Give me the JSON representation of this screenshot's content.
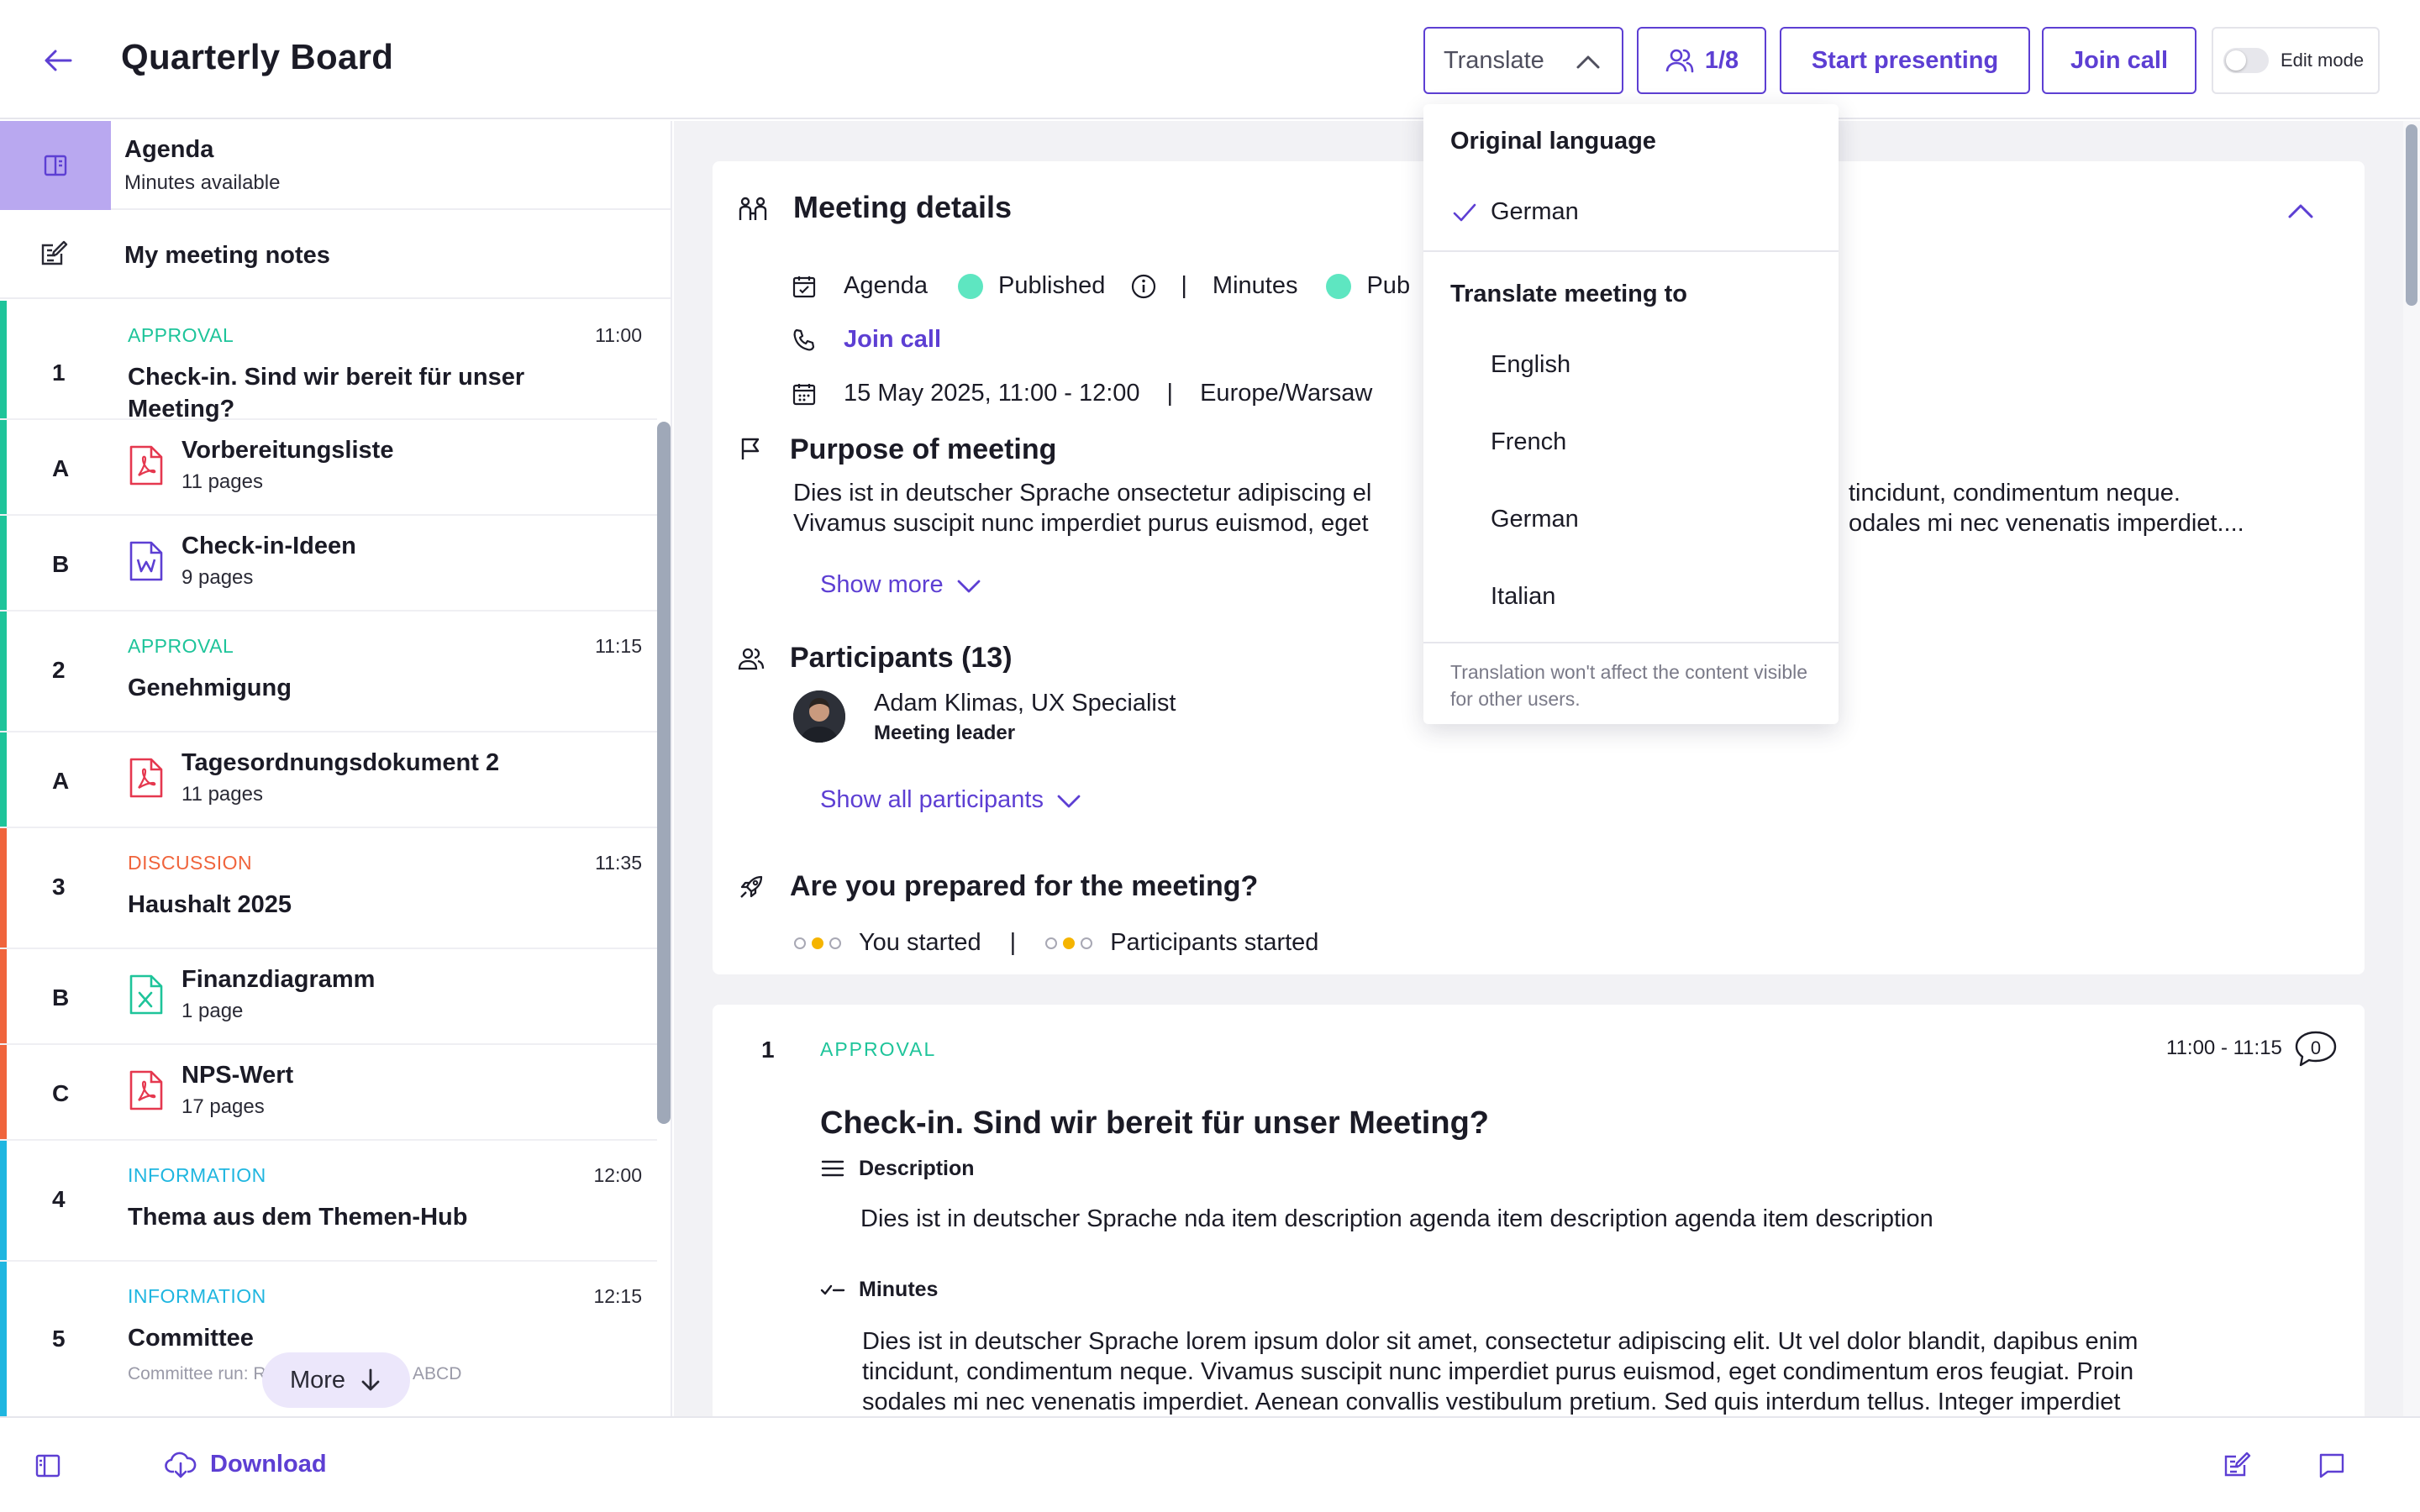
{
  "header": {
    "title": "Quarterly Board",
    "translate_label": "Translate",
    "participants_label": "1/8",
    "start_presenting_label": "Start presenting",
    "join_call_label": "Join call",
    "edit_mode_label": "Edit mode"
  },
  "translate_dropdown": {
    "original_heading": "Original language",
    "original_value": "German",
    "translate_heading": "Translate meeting to",
    "options": [
      "English",
      "French",
      "German",
      "Italian"
    ],
    "note": "Translation won't affect the content visible for other users."
  },
  "sidebar": {
    "agenda_title": "Agenda",
    "agenda_subtitle": "Minutes available",
    "notes_label": "My meeting notes",
    "more_label": "More",
    "items": [
      {
        "kind": "topic",
        "num": "1",
        "type": "APPROVAL",
        "time": "11:00",
        "title": "Check-in. Sind wir bereit für unser Meeting?"
      },
      {
        "kind": "doc",
        "num": "A",
        "name": "Vorbereitungsliste",
        "pages": "11 pages",
        "file": "pdf"
      },
      {
        "kind": "doc",
        "num": "B",
        "name": "Check-in-Ideen",
        "pages": "9 pages",
        "file": "word"
      },
      {
        "kind": "topic",
        "num": "2",
        "type": "APPROVAL",
        "time": "11:15",
        "title": "Genehmigung"
      },
      {
        "kind": "doc",
        "num": "A",
        "name": "Tagesordnungsdokument 2",
        "pages": "11 pages",
        "file": "pdf"
      },
      {
        "kind": "topic",
        "num": "3",
        "type": "DISCUSSION",
        "time": "11:35",
        "title": "Haushalt 2025"
      },
      {
        "kind": "doc",
        "num": "B",
        "name": "Finanzdiagramm",
        "pages": "1 page",
        "file": "excel"
      },
      {
        "kind": "doc",
        "num": "C",
        "name": "NPS-Wert",
        "pages": "17 pages",
        "file": "pdf"
      },
      {
        "kind": "topic",
        "num": "4",
        "type": "INFORMATION",
        "time": "12:00",
        "title": "Thema aus dem Themen-Hub"
      },
      {
        "kind": "topic",
        "num": "5",
        "type": "INFORMATION",
        "time": "12:15",
        "title": "Committee",
        "runs": "Committee run: ROB > AGR > CK > ABCD"
      }
    ]
  },
  "meeting_details": {
    "title": "Meeting details",
    "agenda_label": "Agenda",
    "agenda_status": "Published",
    "minutes_label": "Minutes",
    "minutes_status": "Pub",
    "join_call": "Join call",
    "datetime": "15 May 2025, 11:00 - 12:00",
    "timezone": "Europe/Warsaw",
    "purpose_title": "Purpose of meeting",
    "purpose_line1_a": "Dies ist in deutscher Sprache onsectetur adipiscing el",
    "purpose_line1_b": "tincidunt, condimentum neque.",
    "purpose_line2_a": "Vivamus suscipit nunc imperdiet purus euismod, eget",
    "purpose_line2_b": "odales mi nec venenatis imperdiet....",
    "show_more": "Show more",
    "participants_title": "Participants (13)",
    "leader_name": "Adam Klimas, UX Specialist",
    "leader_role": "Meeting leader",
    "show_all": "Show all participants",
    "prepared_title": "Are you prepared for the meeting?",
    "you_started": "You started",
    "participants_started": "Participants started"
  },
  "agenda_item": {
    "num": "1",
    "type": "APPROVAL",
    "time": "11:00 - 11:15",
    "comments": "0",
    "title": "Check-in. Sind wir bereit für unser Meeting?",
    "description_label": "Description",
    "description_text": "Dies ist in deutscher Sprache nda item description agenda item description agenda item description",
    "minutes_label": "Minutes",
    "minutes_line1": "Dies ist in deutscher Sprache lorem ipsum dolor sit amet, consectetur adipiscing elit. Ut vel dolor blandit, dapibus enim",
    "minutes_line2": "tincidunt, condimentum neque. Vivamus suscipit nunc imperdiet purus euismod, eget condimentum eros feugiat. Proin",
    "minutes_line3": "sodales mi nec venenatis imperdiet. Aenean convallis vestibulum pretium. Sed quis interdum tellus. Integer imperdiet"
  },
  "footer": {
    "download_label": "Download"
  },
  "colors": {
    "accent": "#5d3fd3",
    "approval": "#1ec49a",
    "discussion": "#f0643c",
    "information": "#1fb6e0",
    "published_dot": "#5ee6c1"
  },
  "icons": [
    "arrow-left-icon",
    "chevron-up-icon",
    "users-icon",
    "book-icon",
    "notes-edit-icon",
    "pdf-icon",
    "word-icon",
    "excel-icon",
    "arrow-down-icon",
    "meeting-people-icon",
    "calendar-check-icon",
    "phone-icon",
    "calendar-icon",
    "flag-icon",
    "info-icon",
    "user-group-icon",
    "rocket-icon",
    "menu-lines-icon",
    "checklist-icon",
    "comment-icon",
    "check-icon",
    "cloud-download-icon",
    "panel-icon",
    "chat-icon"
  ]
}
